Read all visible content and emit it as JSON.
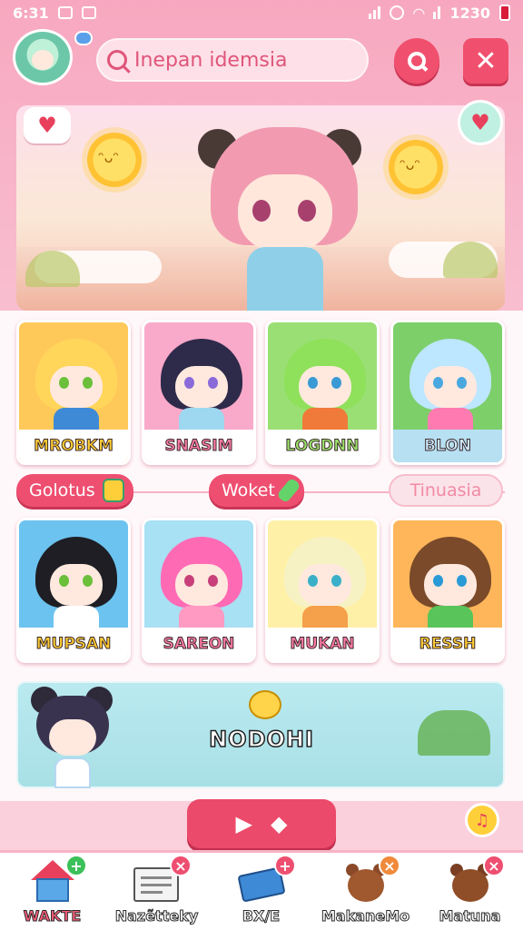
{
  "status_bar": {
    "time": "6:31",
    "right_text": "1230"
  },
  "header": {
    "search": {
      "value": "Inepan idemsia",
      "placeholder": "Inepan idemsia"
    },
    "search_button_icon": "search-icon",
    "close_button_icon": "close-icon"
  },
  "hero": {
    "left_icon": "heart-icon",
    "right_icon": "heart-icon"
  },
  "characters_top": [
    {
      "name": "MROBKM",
      "bg": "#ffc95a",
      "hair": "#ffd65a",
      "eye": "#6bbf3a",
      "body": "#3f8ad6",
      "plate": "yellow"
    },
    {
      "name": "SNASIM",
      "bg": "#f9a9c9",
      "hair": "#2e2a4a",
      "eye": "#8a6ad8",
      "body": "#9dd8f0",
      "plate": "pink"
    },
    {
      "name": "LOGDNN",
      "bg": "#9adf74",
      "hair": "#8fe05a",
      "eye": "#3a9ad6",
      "body": "#f07a3a",
      "plate": "green"
    },
    {
      "name": "BLON",
      "bg": "#7dcf6a",
      "hair": "#bde6ff",
      "eye": "#4aa8e0",
      "body": "#ff7ab0",
      "plate": "blue"
    }
  ],
  "tabs": [
    {
      "label": "Golotus",
      "icon": "gem-icon",
      "icon_color": "#ffcf3a",
      "active": true
    },
    {
      "label": "Woket",
      "icon": "gem-icon",
      "icon_color": "#64d46a",
      "active": true
    },
    {
      "label": "Tinuasia",
      "icon": "",
      "icon_color": "",
      "active": false
    }
  ],
  "characters_bottom": [
    {
      "name": "MUPSAN",
      "bg": "#6cc3ef",
      "hair": "#1e1e24",
      "eye": "#6bbf3a",
      "body": "#ffffff",
      "plate": "yellow"
    },
    {
      "name": "SAREON",
      "bg": "#a8e0f4",
      "hair": "#ff6ab5",
      "eye": "#c8407a",
      "body": "#ff9ac2",
      "plate": "pink"
    },
    {
      "name": "MUKAN",
      "bg": "#fff0a8",
      "hair": "#f6f2c4",
      "eye": "#3ab0c8",
      "body": "#f5a04a",
      "plate": "pink"
    },
    {
      "name": "RESSH",
      "bg": "#ffb65a",
      "hair": "#7a4a2a",
      "eye": "#2a9ad6",
      "body": "#58c45a",
      "plate": "yellow"
    }
  ],
  "banner": {
    "title": "NODOHI"
  },
  "bottom_nav": [
    {
      "label": "WAKTE",
      "icon": "home-icon",
      "badge": "+",
      "badge_color": "#3cc05a",
      "active": true
    },
    {
      "label": "Nazẽtteky",
      "icon": "newspaper-icon",
      "badge": "×",
      "badge_color": "#ee4f70",
      "active": false
    },
    {
      "label": "BX/E",
      "icon": "ticket-icon",
      "badge": "+",
      "badge_color": "#ee4f70",
      "active": false
    },
    {
      "label": "MakaneMo",
      "icon": "bear-icon",
      "badge": "×",
      "badge_color": "#f08a3a",
      "active": false
    },
    {
      "label": "Matuna",
      "icon": "bear-icon",
      "badge": "×",
      "badge_color": "#ee4f70",
      "active": false
    }
  ],
  "colors": {
    "accent": "#ee4f70",
    "background": "#f7a8c0"
  }
}
